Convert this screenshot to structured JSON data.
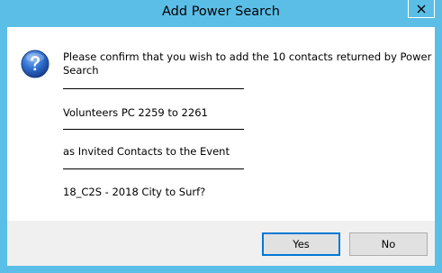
{
  "window": {
    "title": "Add Power Search",
    "close_icon": "close-icon"
  },
  "message": {
    "icon": "question-icon",
    "line1": "Please confirm that you wish to add the 10 contacts returned by Power",
    "line2": "Search",
    "search_name": "Volunteers PC 2259 to 2261",
    "action": "as Invited Contacts to the Event",
    "event": "18_C2S - 2018 City to Surf?"
  },
  "buttons": {
    "yes": "Yes",
    "no": "No"
  },
  "colors": {
    "titlebar": "#5bbee6",
    "default_button_border": "#0078d7"
  }
}
